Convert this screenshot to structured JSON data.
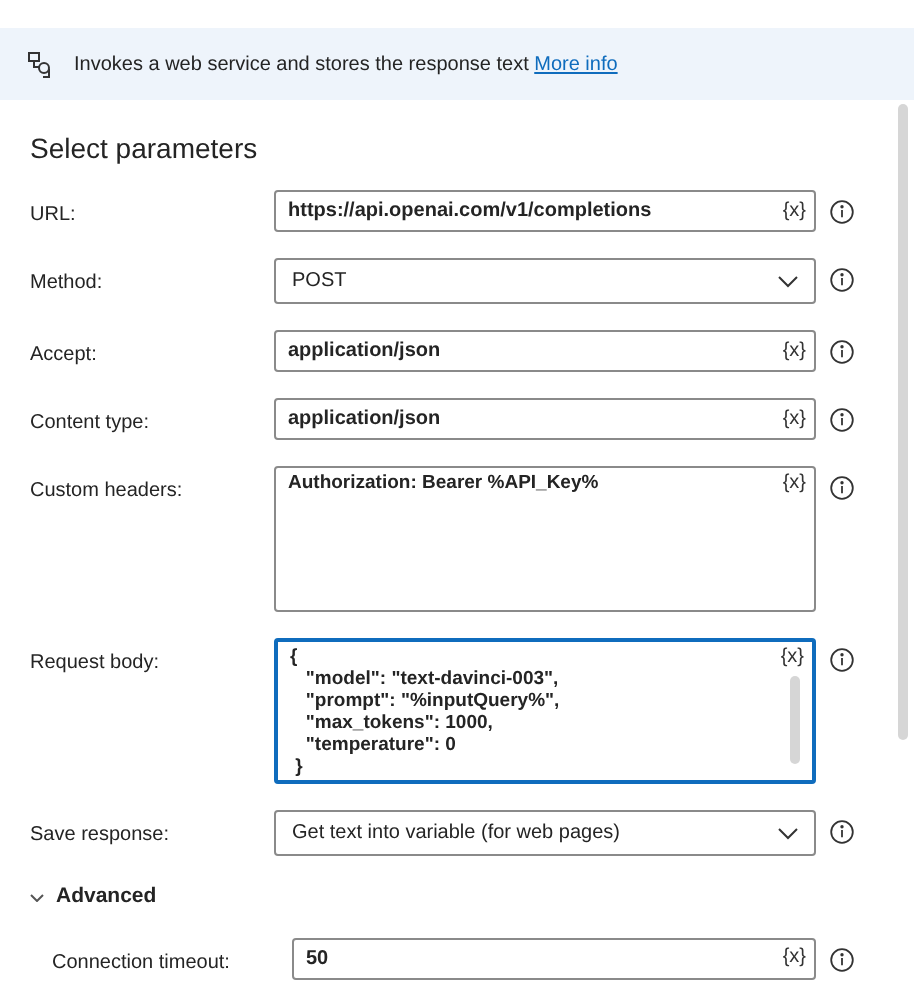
{
  "banner": {
    "description": "Invokes a web service and stores the response text",
    "link": "More info"
  },
  "section_title": "Select parameters",
  "fields": [
    {
      "kind": "text",
      "label": "URL:",
      "value": "https://api.openai.com/v1/completions",
      "var_button": "{x}",
      "focused": false
    },
    {
      "kind": "dropdown",
      "label": "Method:",
      "value": "POST",
      "focused": false
    },
    {
      "kind": "text",
      "label": "Accept:",
      "value": "application/json",
      "var_button": "{x}",
      "focused": false
    },
    {
      "kind": "text",
      "label": "Content type:",
      "value": "application/json",
      "var_button": "{x}",
      "focused": false
    },
    {
      "kind": "textarea",
      "label": "Custom headers:",
      "value": "Authorization: Bearer %API_Key%",
      "var_button": "{x}",
      "focused": false
    },
    {
      "kind": "textarea",
      "label": "Request body:",
      "value": "{\n   \"model\": \"text-davinci-003\",\n   \"prompt\": \"%inputQuery%\",\n   \"max_tokens\": 1000,\n   \"temperature\": 0\n }",
      "var_button": "{x}",
      "focused": true
    },
    {
      "kind": "dropdown",
      "label": "Save response:",
      "value": "Get text into variable (for web pages)",
      "focused": false
    }
  ],
  "advanced": {
    "label": "Advanced",
    "expanded": true,
    "fields": [
      {
        "kind": "text",
        "label": "Connection timeout:",
        "value": "50",
        "var_button": "{x}",
        "focused": false
      }
    ]
  }
}
